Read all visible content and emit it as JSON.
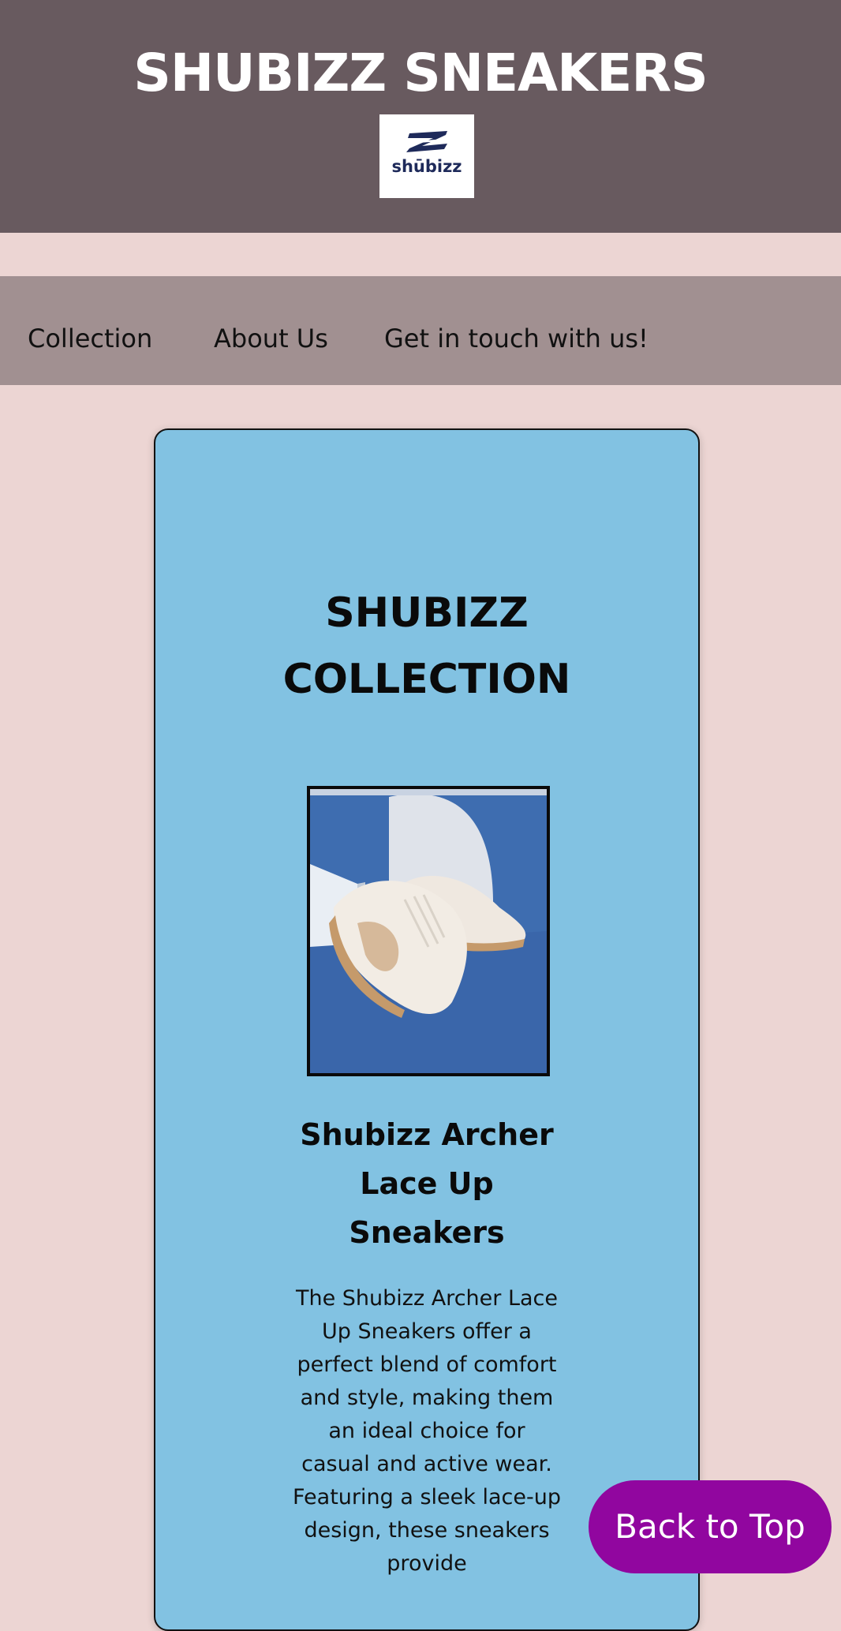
{
  "header": {
    "title": "SHUBIZZ SNEAKERS",
    "logo_text": "shūbizz"
  },
  "nav": {
    "items": [
      {
        "label": "Collection"
      },
      {
        "label": "About Us"
      },
      {
        "label": "Get in touch with us!"
      }
    ]
  },
  "collection": {
    "title_line1": "SHUBIZZ",
    "title_line2": "COLLECTION",
    "product": {
      "name_line1": "Shubizz Archer",
      "name_line2": "Lace Up",
      "name_line3": "Sneakers",
      "description": "The Shubizz Archer Lace Up Sneakers offer a perfect blend of comfort and style, making them an ideal choice for casual and active wear. Featuring a sleek lace-up design, these sneakers provide"
    }
  },
  "back_to_top": {
    "label": "Back to Top"
  },
  "colors": {
    "page_background": "#ecd5d3",
    "header_background": "#685a5f",
    "nav_background": "#a19091",
    "card_background": "#82c2e2",
    "button_background": "#91069f"
  },
  "icons": {
    "logo": "shubizz-logo-icon"
  }
}
